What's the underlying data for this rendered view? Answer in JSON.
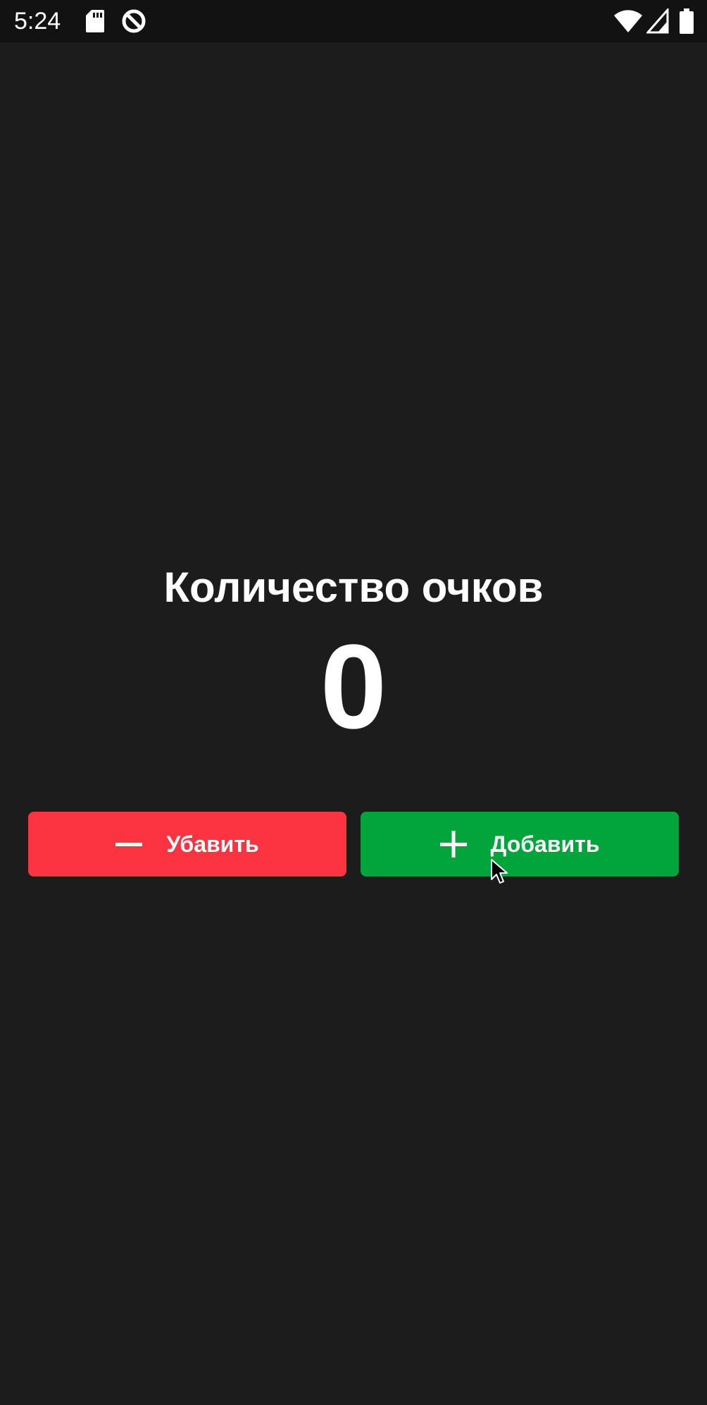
{
  "status_bar": {
    "time": "5:24",
    "icons": [
      "sd-card-icon",
      "data-saver-icon",
      "wifi-icon",
      "signal-icon",
      "battery-icon"
    ]
  },
  "main": {
    "title": "Количество очков",
    "score": "0"
  },
  "buttons": {
    "subtract": {
      "label": "Убавить",
      "icon": "minus-icon",
      "color": "#fc3441"
    },
    "add": {
      "label": "Добавить",
      "icon": "plus-icon",
      "color": "#02a53b"
    }
  },
  "colors": {
    "background": "#1c1c1c",
    "status_bar": "#121212",
    "text": "#ffffff"
  }
}
